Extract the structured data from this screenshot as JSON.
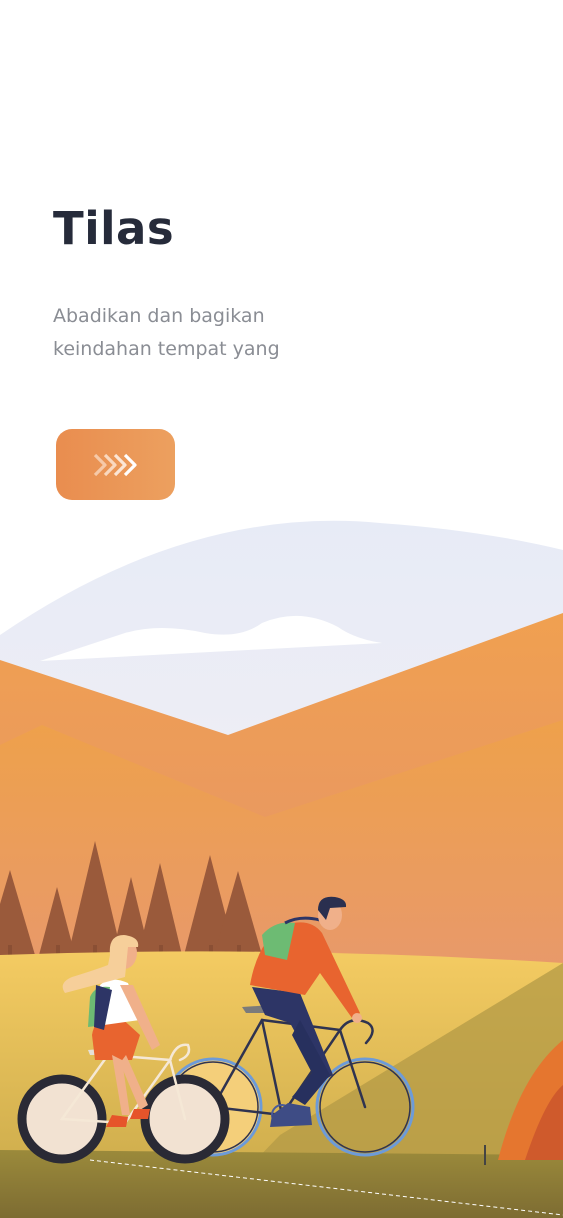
{
  "app": {
    "title": "Tilas",
    "tagline": "Abadikan dan bagikan keindahan tempat yang"
  },
  "actions": {
    "next_icon": "chevron-triple-right-icon"
  },
  "illustration": {
    "subject": "cyclists-landscape-illustration"
  },
  "colors": {
    "title": "#262b3a",
    "tagline": "#8a8d94",
    "accent": "#e98d4f"
  }
}
